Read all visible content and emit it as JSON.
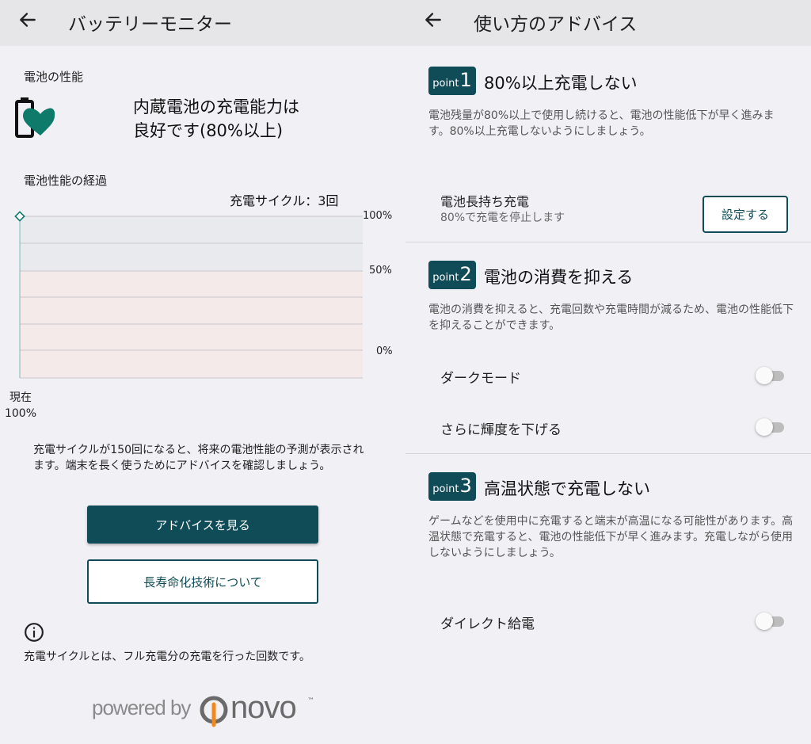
{
  "left": {
    "title": "バッテリーモニター",
    "performance_label": "電池の性能",
    "status_lines": [
      "内蔵電池の充電能力は",
      "良好です(80%以上)"
    ],
    "history_label": "電池性能の経過",
    "cycles_text": "充電サイクル：3回",
    "chart_axis": [
      "100%",
      "50%",
      "0%"
    ],
    "now_label": "現在",
    "now_value": "100%",
    "info_text": "充電サイクルが150回になると、将来の電池性能の予測が表示されます。端末を長く使うためにアドバイスを確認しましょう。",
    "advice_button": "アドバイスを見る",
    "longevity_button": "長寿命化技術について",
    "footnote": "充電サイクルとは、フル充電分の充電を行った回数です。",
    "powered_by": "powered by",
    "brand_word": "novo",
    "brand_tm": "™"
  },
  "right": {
    "title": "使い方のアドバイス",
    "point_word": "point",
    "points": [
      {
        "number": "1",
        "title": "80%以上充電しない",
        "description": "電池残量が80%以上で使用し続けると、電池の性能低下が早く進みます。80%以上充電しないようにしましょう。",
        "setting_title": "電池長持ち充電",
        "setting_sub": "80%で充電を停止します",
        "setting_button": "設定する"
      },
      {
        "number": "2",
        "title": "電池の消費を抑える",
        "description": "電池の消費を抑えると、充電回数や充電時間が減るため、電池の性能低下を抑えることができます。",
        "toggles": [
          {
            "label": "ダークモード",
            "on": false
          },
          {
            "label": "さらに輝度を下げる",
            "on": false
          }
        ]
      },
      {
        "number": "3",
        "title": "高温状態で充電しない",
        "description": "ゲームなどを使用中に充電すると端末が高温になる可能性があります。高温状態で充電すると、電池の性能低下が早く進みます。充電しながら使用しないようにしましょう。",
        "toggles": [
          {
            "label": "ダイレクト給電",
            "on": false
          }
        ]
      }
    ]
  },
  "colors": {
    "accent": "#0f4c58",
    "heart": "#0d7a6a",
    "chart_upper_band": "#e9eaee",
    "chart_lower_band": "#f5eaea",
    "toggle_track": "#bdbdbd"
  },
  "icons": {
    "back": "arrow-left-icon",
    "battery": "battery-heart-icon",
    "info": "info-circle-icon",
    "brand": "onovo-logo-icon"
  },
  "chart_data": {
    "type": "line",
    "x": [
      0
    ],
    "series": [
      {
        "values": [
          100
        ]
      }
    ],
    "ylim": [
      0,
      100
    ],
    "y_ticks": [
      "100%",
      "50%",
      "0%"
    ],
    "grid": true,
    "title": "電池性能の経過",
    "xlabel": "",
    "ylabel": ""
  }
}
